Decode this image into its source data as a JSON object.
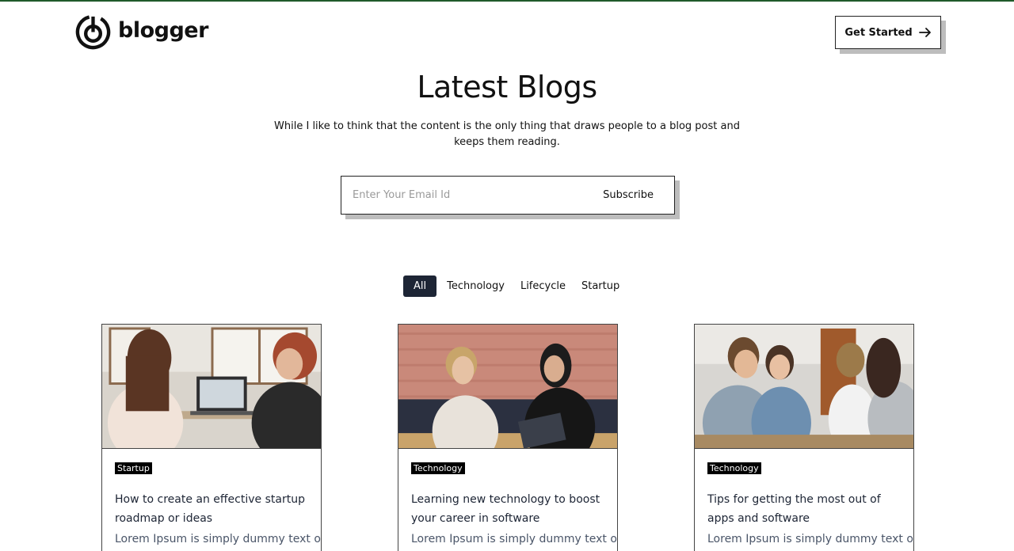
{
  "brand": {
    "name": "blogger"
  },
  "header": {
    "cta_label": "Get Started",
    "cta_icon": "arrow-right-icon"
  },
  "hero": {
    "title": "Latest Blogs",
    "subtitle": "While I like to think that the content is the only thing that draws people to a blog post and keeps them reading."
  },
  "subscribe": {
    "placeholder": "Enter Your Email Id",
    "button_label": "Subscribe"
  },
  "filters": [
    {
      "label": "All",
      "active": true
    },
    {
      "label": "Technology",
      "active": false
    },
    {
      "label": "Lifecycle",
      "active": false
    },
    {
      "label": "Startup",
      "active": false
    }
  ],
  "posts": [
    {
      "category": "Startup",
      "title": "How to create an effective startup roadmap or ideas",
      "excerpt": "Lorem Ipsum is simply dummy text of"
    },
    {
      "category": "Technology",
      "title": "Learning new technology to boost your career in software",
      "excerpt": "Lorem Ipsum is simply dummy text of"
    },
    {
      "category": "Technology",
      "title": "Tips for getting the most out of apps and software",
      "excerpt": "Lorem Ipsum is simply dummy text of"
    }
  ],
  "colors": {
    "accent_line": "#1f5a2a",
    "active_filter_bg": "#1d2535",
    "shadow": "#bdbdbd"
  }
}
